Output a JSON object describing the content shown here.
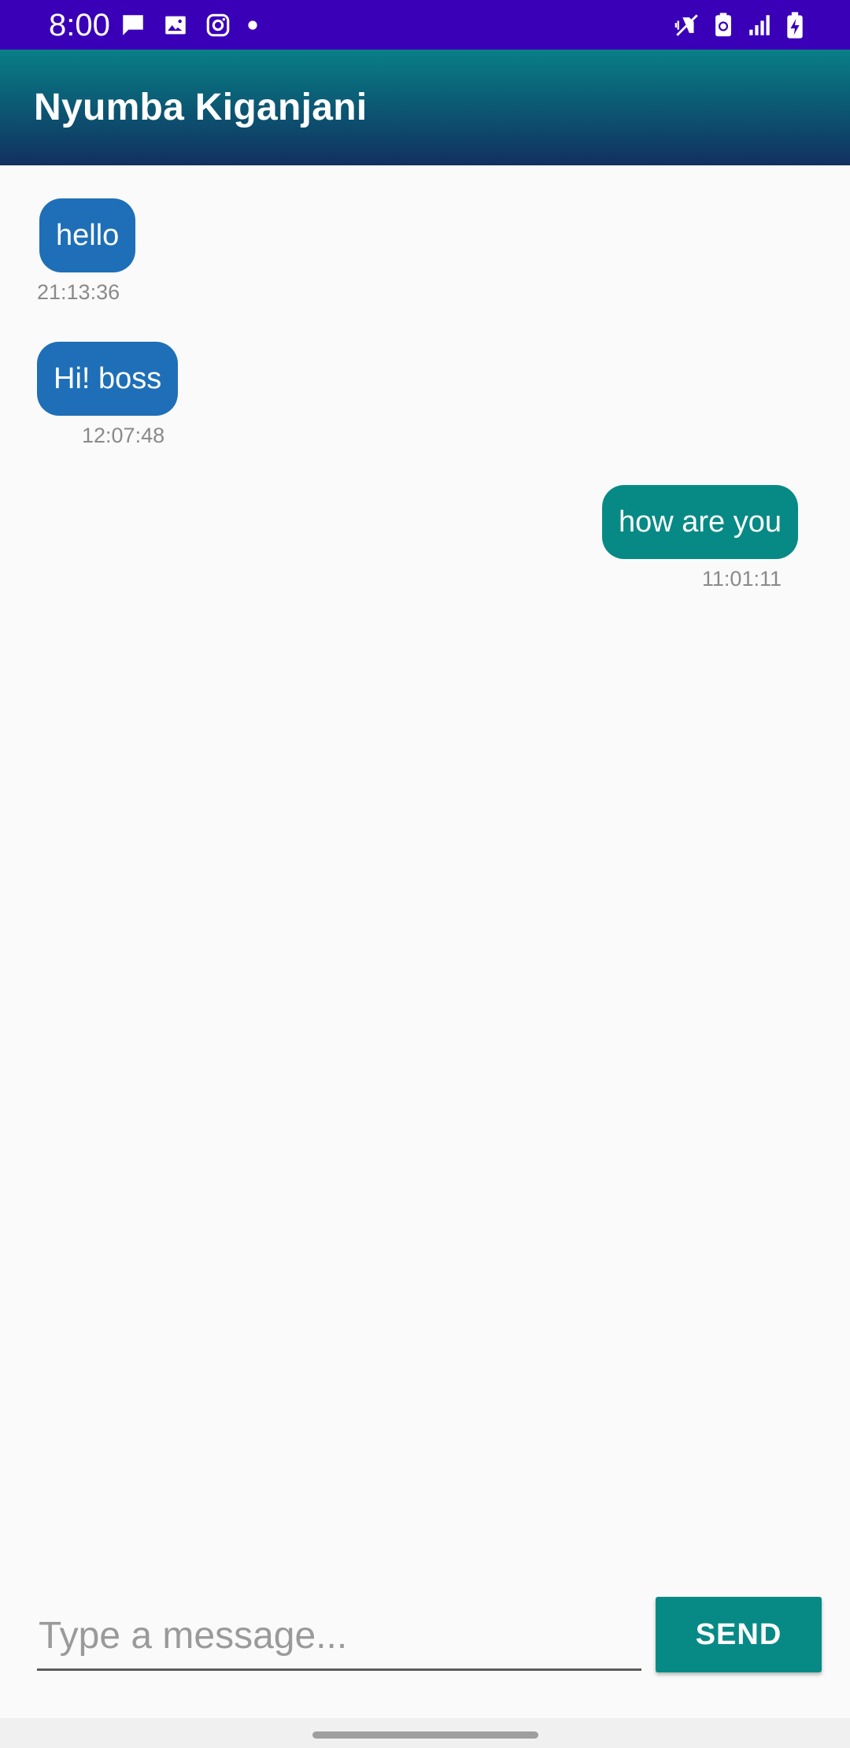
{
  "status_bar": {
    "time": "8:00",
    "left_icons": [
      "message-icon",
      "image-icon",
      "instagram-icon",
      "dot-icon"
    ],
    "right_icons": [
      "vibrate-mute-icon",
      "battery-saver-icon",
      "signal-icon",
      "battery-charging-icon"
    ],
    "background": "#3a00b8"
  },
  "app_bar": {
    "title": "Nyumba Kiganjani",
    "gradient": [
      "#097f86",
      "#123060"
    ]
  },
  "messages": [
    {
      "text": "hello",
      "time": "21:13:36",
      "direction": "received"
    },
    {
      "text": "Hi! boss",
      "time": "12:07:48",
      "direction": "received"
    },
    {
      "text": "how are you",
      "time": "11:01:11",
      "direction": "sent"
    }
  ],
  "colors": {
    "received_bubble": "#1e6fb7",
    "sent_bubble": "#078a85",
    "accent": "#078a85"
  },
  "composer": {
    "value": "",
    "placeholder": "Type a message...",
    "send_label": "SEND"
  }
}
